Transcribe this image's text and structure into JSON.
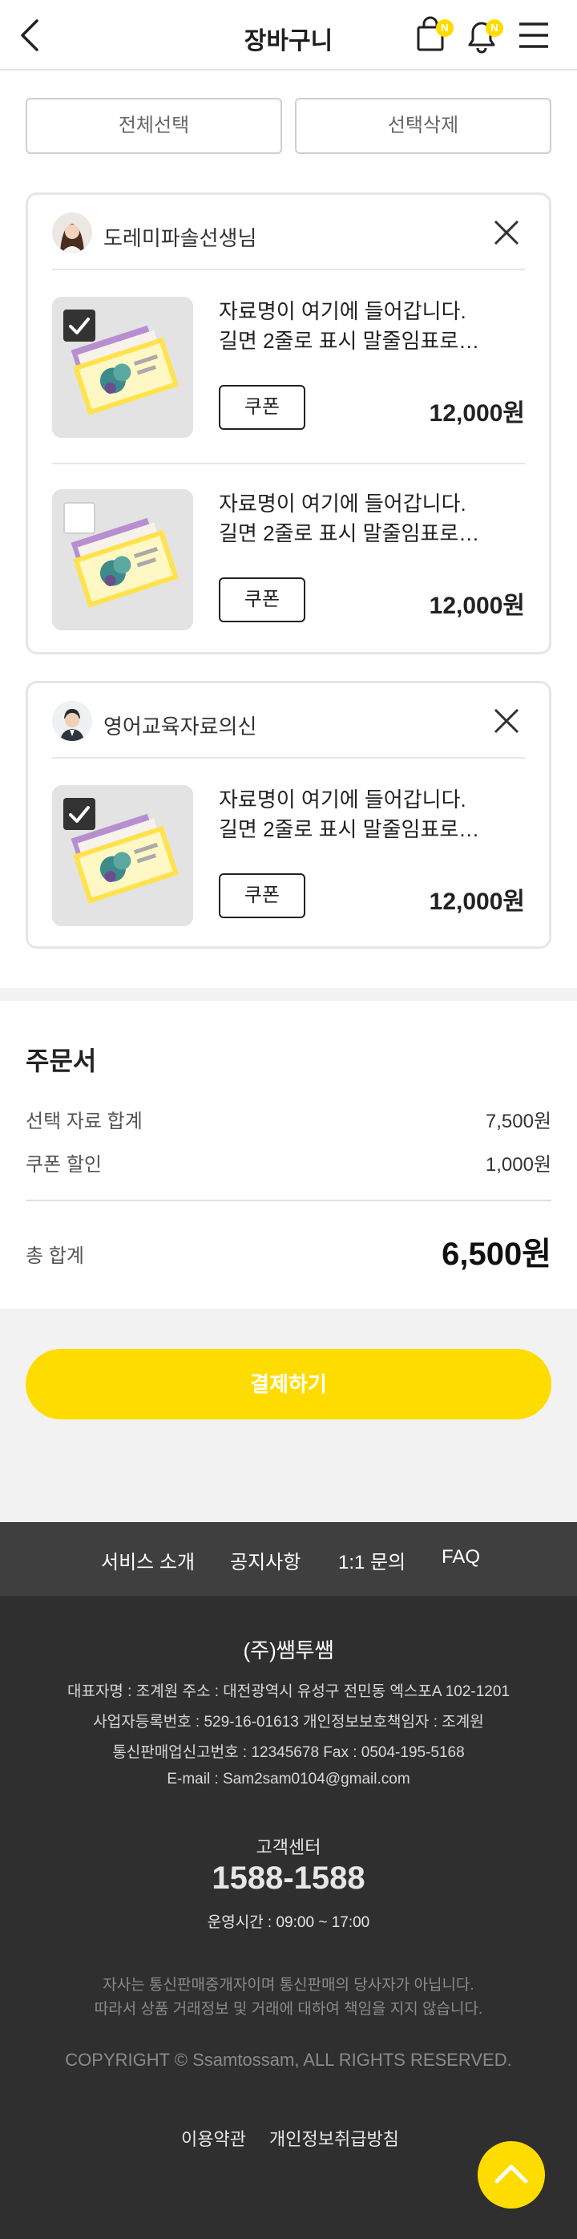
{
  "header": {
    "title": "장바구니",
    "cart_badge": "N",
    "notification_badge": "N",
    "back_icon": "chevron-left-icon",
    "cart_icon": "shopping-bag-icon",
    "bell_icon": "bell-icon",
    "menu_icon": "hamburger-menu-icon"
  },
  "actions": {
    "select_all": "전체선택",
    "delete_selected": "선택삭제"
  },
  "sellers": [
    {
      "name": "도레미파솔선생님",
      "items": [
        {
          "title_line1": "자료명이 여기에 들어갑니다.",
          "title_line2": "길면 2줄로 표시 말줄임표로…",
          "coupon": "쿠폰",
          "price": "12,000원",
          "checked": true
        },
        {
          "title_line1": "자료명이 여기에 들어갑니다.",
          "title_line2": "길면 2줄로 표시 말줄임표로…",
          "coupon": "쿠폰",
          "price": "12,000원",
          "checked": false
        }
      ]
    },
    {
      "name": "영어교육자료의신",
      "items": [
        {
          "title_line1": "자료명이 여기에 들어갑니다.",
          "title_line2": "길면 2줄로 표시 말줄임표로…",
          "coupon": "쿠폰",
          "price": "12,000원",
          "checked": true
        }
      ]
    }
  ],
  "order": {
    "title": "주문서",
    "subtotal_label": "선택 자료 합계",
    "subtotal_value": "7,500원",
    "discount_label": "쿠폰 할인",
    "discount_value": "1,000원",
    "total_label": "총 합계",
    "total_value": "6,500원",
    "pay_button": "결제하기"
  },
  "footer": {
    "nav": [
      "서비스 소개",
      "공지사항",
      "1:1 문의",
      "FAQ"
    ],
    "company": "(주)쌤투쌤",
    "info_line1": "대표자명 : 조계원    주소 : 대전광역시 유성구 전민동 엑스포A 102-1201",
    "info_line2": "사업자등록번호 : 529-16-01613    개인정보보호책임자 : 조계원",
    "info_line3": "통신판매업신고번호 : 12345678    Fax : 0504-195-5168",
    "info_line4": "E-mail : Sam2sam0104@gmail.com",
    "cs_label": "고객센터",
    "cs_phone": "1588-1588",
    "cs_hours": "운영시간 : 09:00 ~ 17:00",
    "notice_line1": "자사는 통신판매중개자이며 통신판매의 당사자가 아닙니다.",
    "notice_line2": "따라서 상품 거래정보 및 거래에 대하여 책임을 지지 않습니다.",
    "copyright": "COPYRIGHT © Ssamtossam, ALL RIGHTS RESERVED.",
    "terms": "이용약관",
    "privacy": "개인정보취급방침",
    "top_icon": "chevron-up-icon"
  },
  "colors": {
    "accent": "#ffdc00",
    "footer_bg": "#2f2f2f",
    "footer_nav_bg": "#3f3f3f"
  }
}
